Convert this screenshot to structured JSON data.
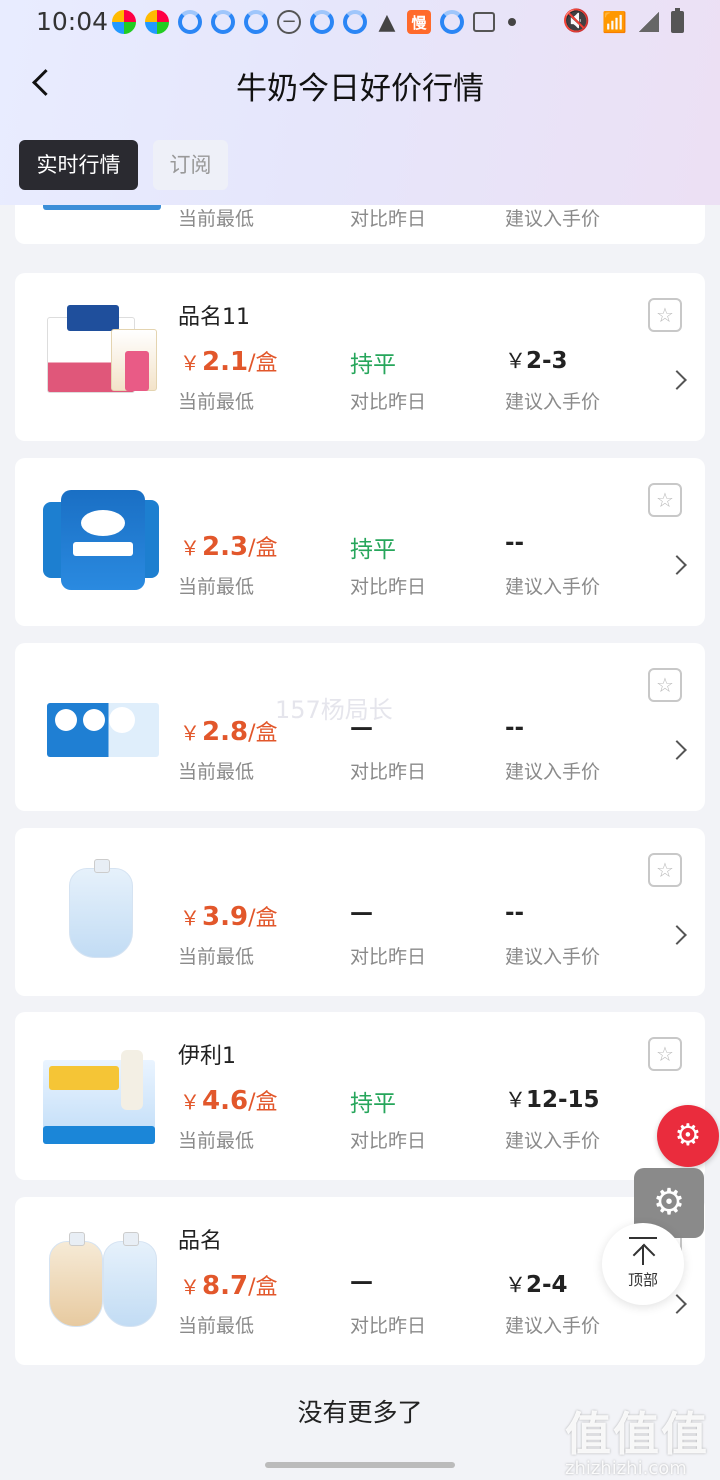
{
  "status_bar": {
    "time": "10:04",
    "man_badge": "慢"
  },
  "header": {
    "title": "牛奶今日好价行情"
  },
  "tabs": [
    {
      "label": "实时行情"
    },
    {
      "label": "订阅"
    }
  ],
  "labels": {
    "current_low": "当前最低",
    "vs_yesterday": "对比昨日",
    "suggest_price": "建议入手价"
  },
  "currency": "￥",
  "items": [
    {
      "name": "",
      "price": "",
      "unit": "",
      "trend": "",
      "suggest": ""
    },
    {
      "name": "品名11",
      "price": "2.1",
      "unit": "/盒",
      "trend": "持平",
      "suggest": "2-3"
    },
    {
      "name": "",
      "price": "2.3",
      "unit": "/盒",
      "trend": "持平",
      "suggest": "--"
    },
    {
      "name": "",
      "price": "2.8",
      "unit": "/盒",
      "trend": "—",
      "suggest": "--"
    },
    {
      "name": "",
      "price": "3.9",
      "unit": "/盒",
      "trend": "—",
      "suggest": "--"
    },
    {
      "name": "伊利1",
      "price": "4.6",
      "unit": "/盒",
      "trend": "持平",
      "suggest": "12-15"
    },
    {
      "name": "品名",
      "price": "8.7",
      "unit": "/盒",
      "trend": "—",
      "suggest": "2-4"
    }
  ],
  "watermark": "157杨局长",
  "end_text": "没有更多了",
  "back_to_top": "顶部",
  "site_watermark": {
    "big": "值值值",
    "small": "zhizhizhi.com"
  },
  "colors": {
    "price": "#e2572b",
    "trend_flat": "#26a65b",
    "active_tab": "#2a2a30"
  }
}
